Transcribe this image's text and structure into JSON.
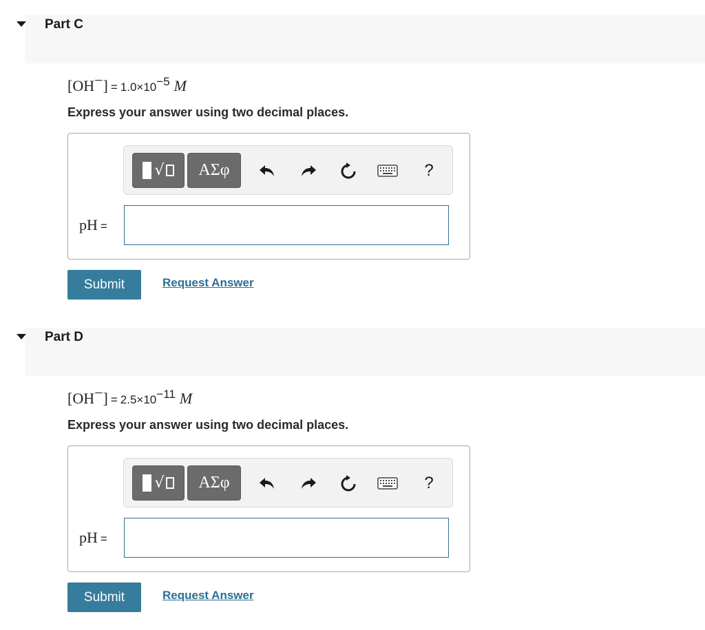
{
  "parts": [
    {
      "title": "Part C",
      "formula": {
        "species": "[OH",
        "charge": "−",
        "close": "]",
        "equals": "=",
        "mantissa": "1.0×10",
        "exponent": "−5",
        "unit": "M"
      },
      "instruction": "Express your answer using two decimal places.",
      "toolbar": {
        "greek_label": "ΑΣφ",
        "help_label": "?"
      },
      "answer": {
        "label": "pH",
        "equals": "=",
        "value": ""
      },
      "submit_label": "Submit",
      "request_label": "Request Answer"
    },
    {
      "title": "Part D",
      "formula": {
        "species": "[OH",
        "charge": "−",
        "close": "]",
        "equals": "=",
        "mantissa": "2.5×10",
        "exponent": "−11",
        "unit": "M"
      },
      "instruction": "Express your answer using two decimal places.",
      "toolbar": {
        "greek_label": "ΑΣφ",
        "help_label": "?"
      },
      "answer": {
        "label": "pH",
        "equals": "=",
        "value": ""
      },
      "submit_label": "Submit",
      "request_label": "Request Answer"
    }
  ],
  "icons": {
    "collapse": "triangle-down-icon",
    "templates": "templates-root-icon",
    "undo": "undo-icon",
    "redo": "redo-icon",
    "reset": "reset-icon",
    "keyboard": "keyboard-icon"
  },
  "colors": {
    "submit_bg": "#367c9c",
    "link": "#2a6f95",
    "input_border": "#2e6e8e",
    "toolbar_dark_btn": "#6b6b6b",
    "header_bg": "#f7f7f7"
  }
}
